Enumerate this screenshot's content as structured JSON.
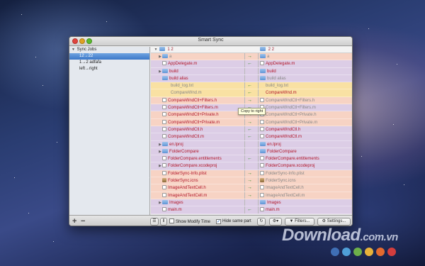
{
  "window": {
    "title": "Smart Sync"
  },
  "sidebar": {
    "header": "Sync Jobs",
    "items": [
      {
        "label": "12→22",
        "selected": true
      },
      {
        "label": "1→2 adfafa",
        "selected": false
      },
      {
        "label": "left→right",
        "selected": false
      }
    ],
    "add_label": "+",
    "remove_label": "−"
  },
  "columns": {
    "left_header": "1 2",
    "right_header": "2 2"
  },
  "rows": [
    {
      "expand": "▶",
      "icon": "folder",
      "left": "a",
      "right": "a",
      "arrow": "→",
      "color": "#f7d3c4",
      "left_style": "gray",
      "right_style": "gray"
    },
    {
      "expand": "",
      "icon": "file",
      "left": "AppDelegate.m",
      "right": "AppDelegate.m",
      "arrow": "←",
      "color": "#dccde6",
      "left_style": "name",
      "right_style": "name"
    },
    {
      "expand": "▶",
      "icon": "folder",
      "left": "build",
      "right": "build",
      "arrow": "",
      "color": "#dccde6",
      "left_style": "name",
      "right_style": "name"
    },
    {
      "expand": "",
      "icon": "folder",
      "left": "build alias",
      "right": "build alias",
      "arrow": "",
      "color": "#dccde6",
      "left_style": "name",
      "right_style": "gray"
    },
    {
      "expand": "",
      "icon": "none",
      "left": "build_log.txt",
      "right": "build_log.txt",
      "arrow": "←",
      "color": "#f9e1a3",
      "left_style": "gray",
      "right_style": "gray"
    },
    {
      "expand": "",
      "icon": "none",
      "left": "CompareWnd.m",
      "right": "CompareWnd.m",
      "arrow": "←",
      "color": "#f9e1a3",
      "left_style": "gray",
      "right_style": "name"
    },
    {
      "expand": "",
      "icon": "file",
      "left": "CompareWndCtl+Filters.h",
      "right": "CompareWndCtl+Filters.h",
      "arrow": "→",
      "color": "#f7d3c4",
      "left_style": "name",
      "right_style": "gray"
    },
    {
      "expand": "",
      "icon": "file",
      "left": "CompareWndCtl+Filters.m",
      "right": "CompareWndCtl+Filters.m",
      "arrow": "←",
      "color": "#dccde6",
      "left_style": "name",
      "right_style": "gray"
    },
    {
      "expand": "",
      "icon": "file",
      "left": "CompareWndCtl+Private.h",
      "right": "CompareWndCtl+Private.h",
      "arrow": "→",
      "color": "#f7d3c4",
      "left_style": "name",
      "right_style": "gray"
    },
    {
      "expand": "",
      "icon": "file",
      "left": "CompareWndCtl+Private.m",
      "right": "CompareWndCtl+Private.m",
      "arrow": "→",
      "color": "#f7d3c4",
      "left_style": "name",
      "right_style": "gray"
    },
    {
      "expand": "",
      "icon": "file",
      "left": "CompareWndCtl.h",
      "right": "CompareWndCtl.h",
      "arrow": "←",
      "color": "#dccde6",
      "left_style": "name",
      "right_style": "name"
    },
    {
      "expand": "",
      "icon": "file",
      "left": "CompareWndCtl.m",
      "right": "CompareWndCtl.m",
      "arrow": "←",
      "color": "#dccde6",
      "left_style": "name",
      "right_style": "name"
    },
    {
      "expand": "▶",
      "icon": "folder",
      "left": "en.lproj",
      "right": "en.lproj",
      "arrow": "",
      "color": "#dccde6",
      "left_style": "name",
      "right_style": "name"
    },
    {
      "expand": "▶",
      "icon": "folder",
      "left": "FolderCompare",
      "right": "FolderCompare",
      "arrow": "",
      "color": "#dccde6",
      "left_style": "name",
      "right_style": "name"
    },
    {
      "expand": "",
      "icon": "file",
      "left": "FolderCompare.entitlements",
      "right": "FolderCompare.entitlements",
      "arrow": "←",
      "color": "#dccde6",
      "left_style": "name",
      "right_style": "name"
    },
    {
      "expand": "▶",
      "icon": "file",
      "left": "FolderCompare.xcodeproj",
      "right": "FolderCompare.xcodeproj",
      "arrow": "",
      "color": "#dccde6",
      "left_style": "name",
      "right_style": "name"
    },
    {
      "expand": "",
      "icon": "file",
      "left": "FolderSync-Info.plist",
      "right": "FolderSync-Info.plist",
      "arrow": "→",
      "color": "#f7d3c4",
      "left_style": "name",
      "right_style": "gray"
    },
    {
      "expand": "",
      "icon": "img",
      "left": "FolderSync.icns",
      "right": "FolderSync.icns",
      "arrow": "→",
      "color": "#f7d3c4",
      "left_style": "name",
      "right_style": "gray"
    },
    {
      "expand": "",
      "icon": "file",
      "left": "ImageAndTextCell.h",
      "right": "ImageAndTextCell.h",
      "arrow": "→",
      "color": "#f7d3c4",
      "left_style": "name",
      "right_style": "gray"
    },
    {
      "expand": "",
      "icon": "file",
      "left": "ImageAndTextCell.m",
      "right": "ImageAndTextCell.m",
      "arrow": "→",
      "color": "#f7d3c4",
      "left_style": "name",
      "right_style": "gray"
    },
    {
      "expand": "▶",
      "icon": "folder",
      "left": "Images",
      "right": "Images",
      "arrow": "",
      "color": "#dccde6",
      "left_style": "name",
      "right_style": "name"
    },
    {
      "expand": "",
      "icon": "file",
      "left": "main.m",
      "right": "main.m",
      "arrow": "←",
      "color": "#dccde6",
      "left_style": "name",
      "right_style": "name"
    }
  ],
  "tooltip": "Copy to right",
  "toolbar": {
    "show_modify_time": "Show Modify Time",
    "show_modify_time_checked": false,
    "hide_same_part": "Hide same part",
    "hide_same_part_checked": true,
    "filters_label": "Filters...",
    "settings_label": "Settings..."
  },
  "watermark": {
    "text": "Download",
    "suffix": ".com.vn",
    "dot_colors": [
      "#3f6fb5",
      "#4f9fd8",
      "#6db04a",
      "#e8b23a",
      "#e36a2f",
      "#d33d3d"
    ]
  }
}
